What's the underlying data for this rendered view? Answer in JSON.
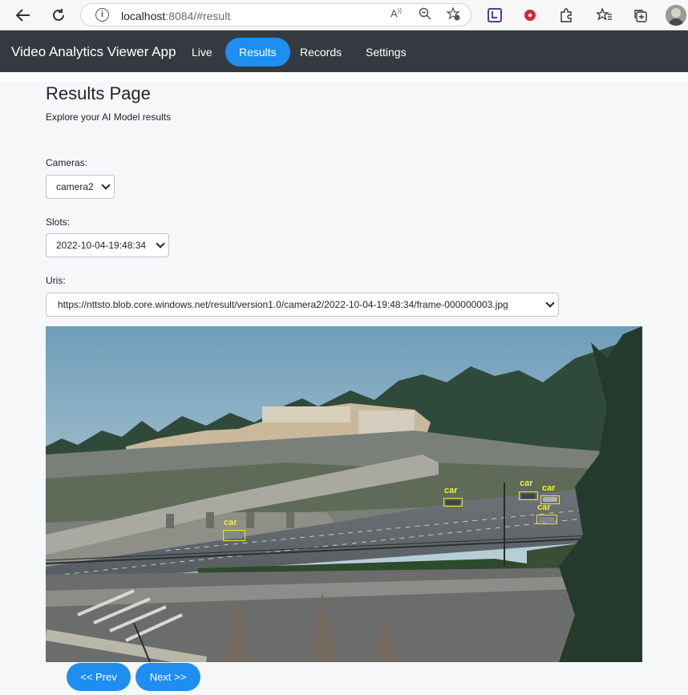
{
  "browser": {
    "url_host": "localhost",
    "url_rest": ":8084/#result",
    "icons": [
      "back-arrow-icon",
      "reload-icon",
      "info-icon",
      "read-aloud-icon",
      "zoom-out-icon",
      "favorite-add-icon",
      "extension-square-icon",
      "red-record-icon",
      "puzzle-icon",
      "favorites-icon",
      "collections-icon",
      "profile-avatar"
    ]
  },
  "navbar": {
    "brand": "Video Analytics Viewer App",
    "links": [
      {
        "label": "Live",
        "active": false
      },
      {
        "label": "Results",
        "active": true
      },
      {
        "label": "Records",
        "active": false
      },
      {
        "label": "Settings",
        "active": false
      }
    ]
  },
  "page": {
    "title": "Results Page",
    "subtitle": "Explore your AI Model results"
  },
  "cameras": {
    "label": "Cameras:",
    "value": "camera2"
  },
  "slots": {
    "label": "Slots:",
    "value": "2022-10-04-19:48:34"
  },
  "uris": {
    "label": "Uris:",
    "value": "https://nttsto.blob.core.windows.net/result/version1.0/camera2/2022-10-04-19:48:34/frame-000000003.jpg"
  },
  "detections": [
    "car",
    "car",
    "car",
    "car",
    "car"
  ],
  "pager": {
    "prev": "<< Prev",
    "next": "Next >>"
  },
  "colors": {
    "navbar": "#343a40",
    "accent": "#1e8ef0",
    "detection": "#e6e62c"
  }
}
